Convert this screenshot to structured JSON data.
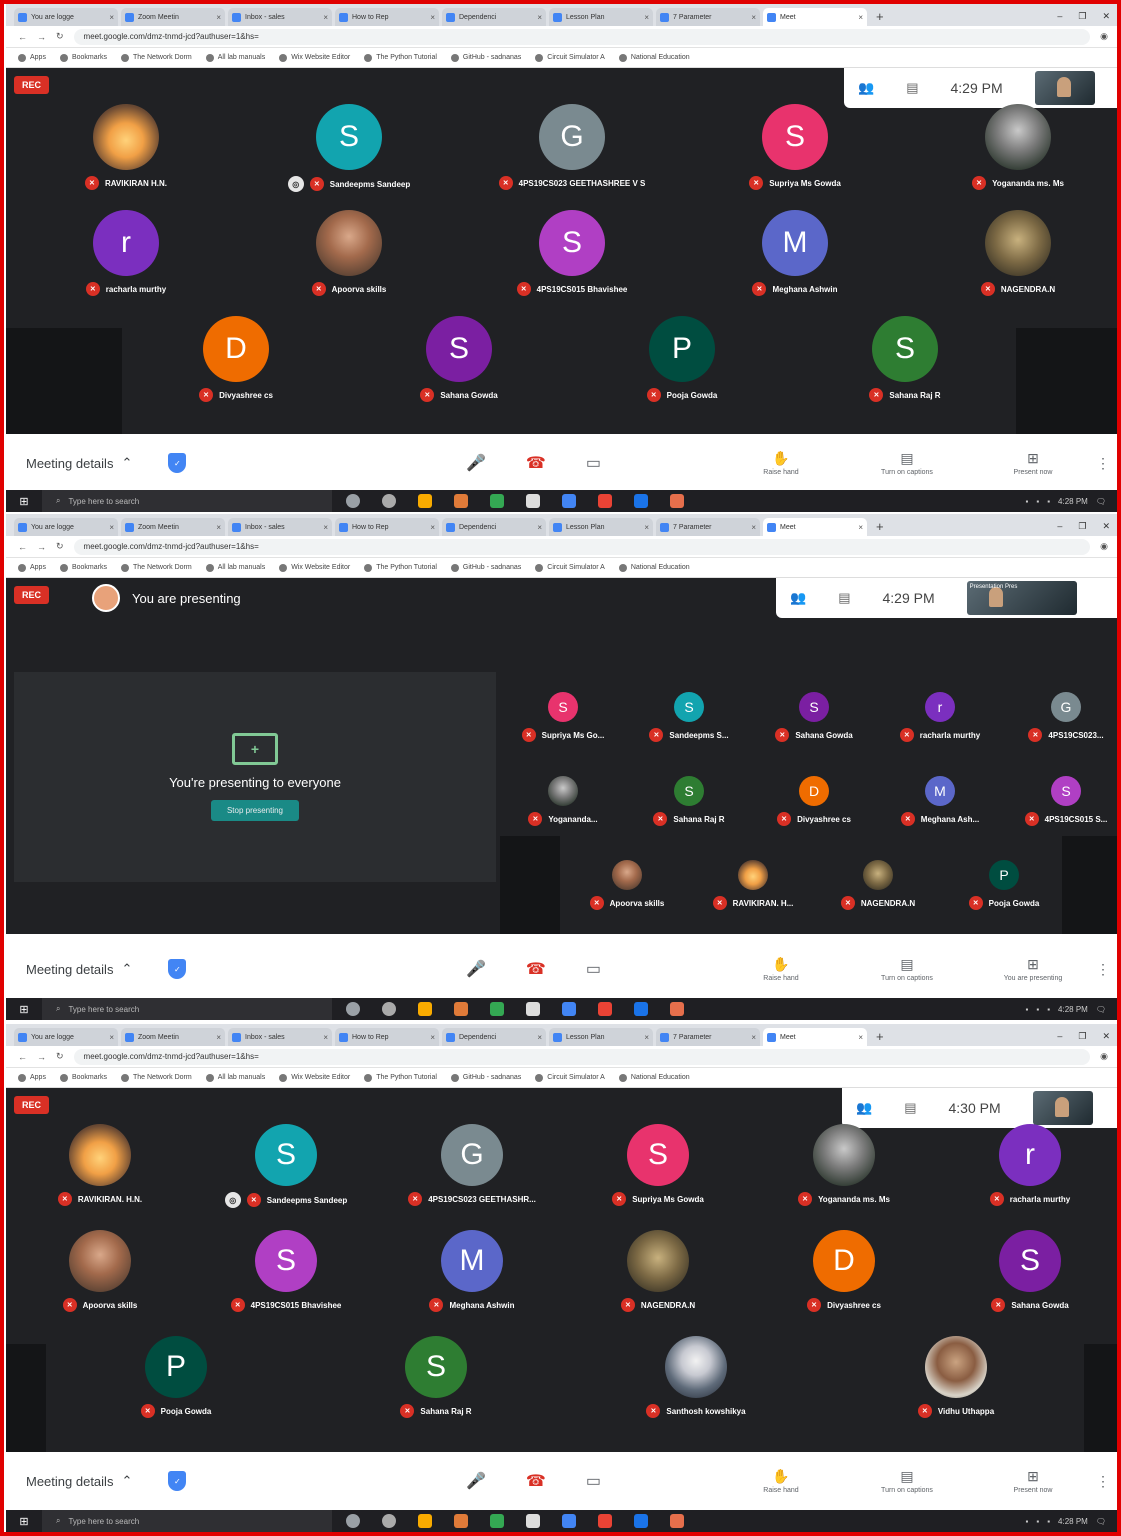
{
  "browser": {
    "tabs": [
      "You are logge",
      "Zoom Meetin",
      "Inbox - sales",
      "How to Rep",
      "Dependenci",
      "Lesson Plan",
      "7 Parameter",
      "Meet"
    ],
    "url": "meet.google.com/dmz-tnmd-jcd?authuser=1&hs=",
    "bookmarks": [
      "Apps",
      "Bookmarks",
      "The Network Dorm",
      "All lab manuals",
      "Wix Website Editor",
      "The Python Tutorial",
      "GitHub - sadnanas",
      "Circuit Simulator A",
      "National Education"
    ]
  },
  "taskbar": {
    "search": "Type here to search",
    "clock": "4:28 PM"
  },
  "panel1": {
    "rec": "REC",
    "time": "4:29 PM",
    "participants": [
      {
        "name": "RAVIKIRAN H.N.",
        "letter": "",
        "color": "",
        "photo": "p1"
      },
      {
        "name": "Sandeepms Sandeep",
        "letter": "S",
        "color": "#12a4af",
        "photo": "",
        "pinned": true
      },
      {
        "name": "4PS19CS023 GEETHASHREE V S",
        "letter": "G",
        "color": "#7a8a90",
        "photo": ""
      },
      {
        "name": "Supriya Ms Gowda",
        "letter": "S",
        "color": "#e8336d",
        "photo": ""
      },
      {
        "name": "Yogananda ms. Ms",
        "letter": "",
        "color": "",
        "photo": "p2"
      },
      {
        "name": "racharla murthy",
        "letter": "r",
        "color": "#7b2fbf",
        "photo": ""
      },
      {
        "name": "Apoorva skills",
        "letter": "",
        "color": "",
        "photo": "p3"
      },
      {
        "name": "4PS19CS015 Bhavishee",
        "letter": "S",
        "color": "#b03fc4",
        "photo": ""
      },
      {
        "name": "Meghana Ashwin",
        "letter": "M",
        "color": "#5b67c9",
        "photo": ""
      },
      {
        "name": "NAGENDRA.N",
        "letter": "",
        "color": "",
        "photo": "p4"
      },
      {
        "name": "Divyashree cs",
        "letter": "D",
        "color": "#ef6c00",
        "photo": ""
      },
      {
        "name": "Sahana Gowda",
        "letter": "S",
        "color": "#7b1fa2",
        "photo": ""
      },
      {
        "name": "Pooja Gowda",
        "letter": "P",
        "color": "#004d40",
        "photo": ""
      },
      {
        "name": "Sahana Raj R",
        "letter": "S",
        "color": "#2e7d32",
        "photo": ""
      }
    ]
  },
  "panel2": {
    "rec": "REC",
    "time": "4:29 PM",
    "presenting": "You are presenting",
    "card_text": "You're presenting to everyone",
    "stop": "Stop presenting",
    "thumb_label": "Presentation Pres",
    "participants": [
      {
        "name": "Supriya Ms Go...",
        "letter": "S",
        "color": "#e8336d",
        "photo": ""
      },
      {
        "name": "Sandeepms S...",
        "letter": "S",
        "color": "#12a4af",
        "photo": ""
      },
      {
        "name": "Sahana Gowda",
        "letter": "S",
        "color": "#7b1fa2",
        "photo": ""
      },
      {
        "name": "racharla murthy",
        "letter": "r",
        "color": "#7b2fbf",
        "photo": ""
      },
      {
        "name": "4PS19CS023...",
        "letter": "G",
        "color": "#7a8a90",
        "photo": ""
      },
      {
        "name": "Yogananda...",
        "letter": "",
        "color": "",
        "photo": "p2"
      },
      {
        "name": "Sahana Raj R",
        "letter": "S",
        "color": "#2e7d32",
        "photo": ""
      },
      {
        "name": "Divyashree cs",
        "letter": "D",
        "color": "#ef6c00",
        "photo": ""
      },
      {
        "name": "Meghana Ash...",
        "letter": "M",
        "color": "#5b67c9",
        "photo": ""
      },
      {
        "name": "4PS19CS015 S...",
        "letter": "S",
        "color": "#b03fc4",
        "photo": ""
      },
      {
        "name": "Apoorva skills",
        "letter": "",
        "color": "",
        "photo": "p3"
      },
      {
        "name": "RAVIKIRAN. H...",
        "letter": "",
        "color": "",
        "photo": "p1"
      },
      {
        "name": "NAGENDRA.N",
        "letter": "",
        "color": "",
        "photo": "p4"
      },
      {
        "name": "Pooja Gowda",
        "letter": "P",
        "color": "#004d40",
        "photo": ""
      }
    ]
  },
  "panel3": {
    "rec": "REC",
    "time": "4:30 PM",
    "participants": [
      {
        "name": "RAVIKIRAN. H.N.",
        "letter": "",
        "color": "",
        "photo": "p1"
      },
      {
        "name": "Sandeepms Sandeep",
        "letter": "S",
        "color": "#12a4af",
        "photo": "",
        "pinned": true
      },
      {
        "name": "4PS19CS023 GEETHASHR...",
        "letter": "G",
        "color": "#7a8a90",
        "photo": ""
      },
      {
        "name": "Supriya Ms Gowda",
        "letter": "S",
        "color": "#e8336d",
        "photo": ""
      },
      {
        "name": "Yogananda ms. Ms",
        "letter": "",
        "color": "",
        "photo": "p2"
      },
      {
        "name": "racharla murthy",
        "letter": "r",
        "color": "#7b2fbf",
        "photo": ""
      },
      {
        "name": "Apoorva skills",
        "letter": "",
        "color": "",
        "photo": "p3"
      },
      {
        "name": "4PS19CS015 Bhavishee",
        "letter": "S",
        "color": "#b03fc4",
        "photo": ""
      },
      {
        "name": "Meghana Ashwin",
        "letter": "M",
        "color": "#5b67c9",
        "photo": ""
      },
      {
        "name": "NAGENDRA.N",
        "letter": "",
        "color": "",
        "photo": "p4"
      },
      {
        "name": "Divyashree cs",
        "letter": "D",
        "color": "#ef6c00",
        "photo": ""
      },
      {
        "name": "Sahana Gowda",
        "letter": "S",
        "color": "#7b1fa2",
        "photo": ""
      },
      {
        "name": "Pooja Gowda",
        "letter": "P",
        "color": "#004d40",
        "photo": ""
      },
      {
        "name": "Sahana Raj R",
        "letter": "S",
        "color": "#2e7d32",
        "photo": ""
      },
      {
        "name": "Santhosh kowshikya",
        "letter": "",
        "color": "",
        "photo": "p5"
      },
      {
        "name": "Vidhu Uthappa",
        "letter": "",
        "color": "",
        "photo": "p6"
      }
    ]
  },
  "toolbar": {
    "meeting_details": "Meeting details",
    "raise_hand": "Raise hand",
    "captions": "Turn on captions",
    "present_now": "Present now",
    "you_are_presenting": "You are presenting"
  }
}
